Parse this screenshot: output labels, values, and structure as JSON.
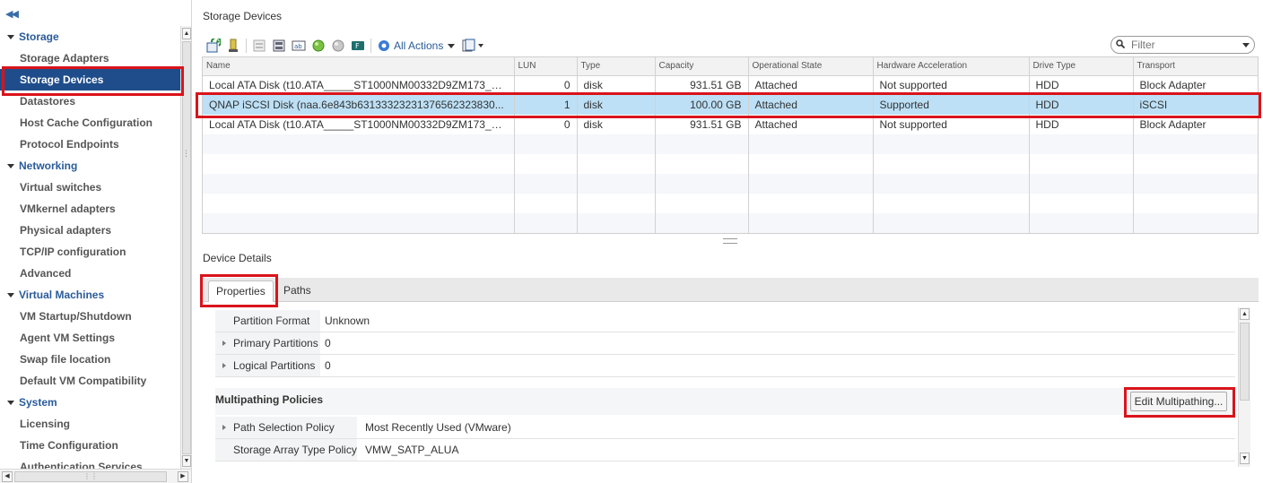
{
  "sidebar": {
    "collapse_icon": "double-chevron-left-icon",
    "groups": [
      {
        "label": "Storage",
        "items": [
          "Storage Adapters",
          "Storage Devices",
          "Datastores",
          "Host Cache Configuration",
          "Protocol Endpoints"
        ]
      },
      {
        "label": "Networking",
        "items": [
          "Virtual switches",
          "VMkernel adapters",
          "Physical adapters",
          "TCP/IP configuration",
          "Advanced"
        ]
      },
      {
        "label": "Virtual Machines",
        "items": [
          "VM Startup/Shutdown",
          "Agent VM Settings",
          "Swap file location",
          "Default VM Compatibility"
        ]
      },
      {
        "label": "System",
        "items": [
          "Licensing",
          "Time Configuration",
          "Authentication Services"
        ]
      }
    ],
    "selected_item": "Storage Devices"
  },
  "panel": {
    "title": "Storage Devices",
    "toolbar": {
      "icons": [
        "refresh-icon",
        "attach-icon",
        "detach-icon",
        "rescan-icon",
        "rename-icon",
        "green-led-icon",
        "grey-led-icon",
        "flash-icon"
      ],
      "all_actions_label": "All Actions",
      "export_icon": "export-list-icon"
    },
    "filter": {
      "placeholder": "Filter"
    },
    "columns": [
      "Name",
      "LUN",
      "Type",
      "Capacity",
      "Operational State",
      "Hardware Acceleration",
      "Drive Type",
      "Transport"
    ],
    "rows": [
      {
        "name": "Local ATA Disk (t10.ATA_____ST1000NM00332D9ZM173___...",
        "lun": "0",
        "type": "disk",
        "capacity": "931.51 GB",
        "state": "Attached",
        "hw_accel": "Not supported",
        "drive": "HDD",
        "transport": "Block Adapter"
      },
      {
        "name": "QNAP iSCSI Disk (naa.6e843b63133323231376562323830...",
        "lun": "1",
        "type": "disk",
        "capacity": "100.00 GB",
        "state": "Attached",
        "hw_accel": "Supported",
        "drive": "HDD",
        "transport": "iSCSI"
      },
      {
        "name": "Local ATA Disk (t10.ATA_____ST1000NM00332D9ZM173___...",
        "lun": "0",
        "type": "disk",
        "capacity": "931.51 GB",
        "state": "Attached",
        "hw_accel": "Not supported",
        "drive": "HDD",
        "transport": "Block Adapter"
      }
    ],
    "selected_row": 1
  },
  "details": {
    "title": "Device Details",
    "tabs": [
      "Properties",
      "Paths"
    ],
    "active_tab": "Properties",
    "properties": [
      {
        "label": "Partition Format",
        "value": "Unknown",
        "expandable": false
      },
      {
        "label": "Primary Partitions",
        "value": "0",
        "expandable": true
      },
      {
        "label": "Logical Partitions",
        "value": "0",
        "expandable": true
      }
    ],
    "multipathing": {
      "title": "Multipathing Policies",
      "edit_button": "Edit Multipathing...",
      "rows": [
        {
          "label": "Path Selection Policy",
          "value": "Most Recently Used (VMware)",
          "expandable": true
        },
        {
          "label": "Storage Array Type Policy",
          "value": "VMW_SATP_ALUA",
          "expandable": false
        }
      ]
    }
  },
  "colors": {
    "nav_selected_bg": "#1f4d8b",
    "row_selected_bg": "#bde0f6",
    "highlight_red": "#d9141b",
    "link_blue": "#2a5b9a"
  }
}
